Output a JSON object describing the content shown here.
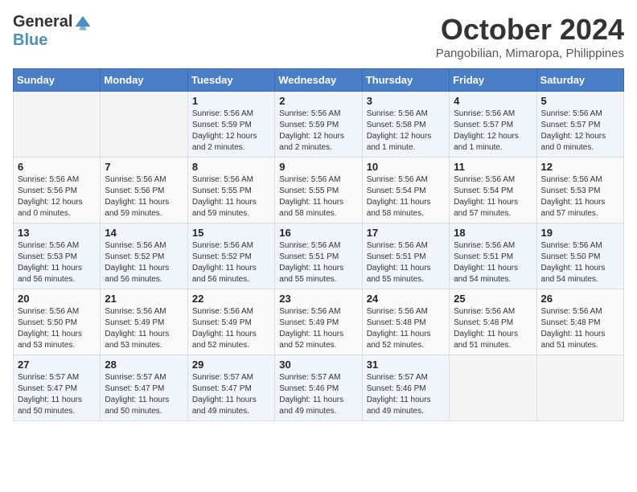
{
  "header": {
    "logo_general": "General",
    "logo_blue": "Blue",
    "month_title": "October 2024",
    "subtitle": "Pangobilian, Mimaropa, Philippines"
  },
  "days_of_week": [
    "Sunday",
    "Monday",
    "Tuesday",
    "Wednesday",
    "Thursday",
    "Friday",
    "Saturday"
  ],
  "weeks": [
    [
      {
        "day": "",
        "info": ""
      },
      {
        "day": "",
        "info": ""
      },
      {
        "day": "1",
        "info": "Sunrise: 5:56 AM\nSunset: 5:59 PM\nDaylight: 12 hours\nand 2 minutes."
      },
      {
        "day": "2",
        "info": "Sunrise: 5:56 AM\nSunset: 5:59 PM\nDaylight: 12 hours\nand 2 minutes."
      },
      {
        "day": "3",
        "info": "Sunrise: 5:56 AM\nSunset: 5:58 PM\nDaylight: 12 hours\nand 1 minute."
      },
      {
        "day": "4",
        "info": "Sunrise: 5:56 AM\nSunset: 5:57 PM\nDaylight: 12 hours\nand 1 minute."
      },
      {
        "day": "5",
        "info": "Sunrise: 5:56 AM\nSunset: 5:57 PM\nDaylight: 12 hours\nand 0 minutes."
      }
    ],
    [
      {
        "day": "6",
        "info": "Sunrise: 5:56 AM\nSunset: 5:56 PM\nDaylight: 12 hours\nand 0 minutes."
      },
      {
        "day": "7",
        "info": "Sunrise: 5:56 AM\nSunset: 5:56 PM\nDaylight: 11 hours\nand 59 minutes."
      },
      {
        "day": "8",
        "info": "Sunrise: 5:56 AM\nSunset: 5:55 PM\nDaylight: 11 hours\nand 59 minutes."
      },
      {
        "day": "9",
        "info": "Sunrise: 5:56 AM\nSunset: 5:55 PM\nDaylight: 11 hours\nand 58 minutes."
      },
      {
        "day": "10",
        "info": "Sunrise: 5:56 AM\nSunset: 5:54 PM\nDaylight: 11 hours\nand 58 minutes."
      },
      {
        "day": "11",
        "info": "Sunrise: 5:56 AM\nSunset: 5:54 PM\nDaylight: 11 hours\nand 57 minutes."
      },
      {
        "day": "12",
        "info": "Sunrise: 5:56 AM\nSunset: 5:53 PM\nDaylight: 11 hours\nand 57 minutes."
      }
    ],
    [
      {
        "day": "13",
        "info": "Sunrise: 5:56 AM\nSunset: 5:53 PM\nDaylight: 11 hours\nand 56 minutes."
      },
      {
        "day": "14",
        "info": "Sunrise: 5:56 AM\nSunset: 5:52 PM\nDaylight: 11 hours\nand 56 minutes."
      },
      {
        "day": "15",
        "info": "Sunrise: 5:56 AM\nSunset: 5:52 PM\nDaylight: 11 hours\nand 56 minutes."
      },
      {
        "day": "16",
        "info": "Sunrise: 5:56 AM\nSunset: 5:51 PM\nDaylight: 11 hours\nand 55 minutes."
      },
      {
        "day": "17",
        "info": "Sunrise: 5:56 AM\nSunset: 5:51 PM\nDaylight: 11 hours\nand 55 minutes."
      },
      {
        "day": "18",
        "info": "Sunrise: 5:56 AM\nSunset: 5:51 PM\nDaylight: 11 hours\nand 54 minutes."
      },
      {
        "day": "19",
        "info": "Sunrise: 5:56 AM\nSunset: 5:50 PM\nDaylight: 11 hours\nand 54 minutes."
      }
    ],
    [
      {
        "day": "20",
        "info": "Sunrise: 5:56 AM\nSunset: 5:50 PM\nDaylight: 11 hours\nand 53 minutes."
      },
      {
        "day": "21",
        "info": "Sunrise: 5:56 AM\nSunset: 5:49 PM\nDaylight: 11 hours\nand 53 minutes."
      },
      {
        "day": "22",
        "info": "Sunrise: 5:56 AM\nSunset: 5:49 PM\nDaylight: 11 hours\nand 52 minutes."
      },
      {
        "day": "23",
        "info": "Sunrise: 5:56 AM\nSunset: 5:49 PM\nDaylight: 11 hours\nand 52 minutes."
      },
      {
        "day": "24",
        "info": "Sunrise: 5:56 AM\nSunset: 5:48 PM\nDaylight: 11 hours\nand 52 minutes."
      },
      {
        "day": "25",
        "info": "Sunrise: 5:56 AM\nSunset: 5:48 PM\nDaylight: 11 hours\nand 51 minutes."
      },
      {
        "day": "26",
        "info": "Sunrise: 5:56 AM\nSunset: 5:48 PM\nDaylight: 11 hours\nand 51 minutes."
      }
    ],
    [
      {
        "day": "27",
        "info": "Sunrise: 5:57 AM\nSunset: 5:47 PM\nDaylight: 11 hours\nand 50 minutes."
      },
      {
        "day": "28",
        "info": "Sunrise: 5:57 AM\nSunset: 5:47 PM\nDaylight: 11 hours\nand 50 minutes."
      },
      {
        "day": "29",
        "info": "Sunrise: 5:57 AM\nSunset: 5:47 PM\nDaylight: 11 hours\nand 49 minutes."
      },
      {
        "day": "30",
        "info": "Sunrise: 5:57 AM\nSunset: 5:46 PM\nDaylight: 11 hours\nand 49 minutes."
      },
      {
        "day": "31",
        "info": "Sunrise: 5:57 AM\nSunset: 5:46 PM\nDaylight: 11 hours\nand 49 minutes."
      },
      {
        "day": "",
        "info": ""
      },
      {
        "day": "",
        "info": ""
      }
    ]
  ]
}
